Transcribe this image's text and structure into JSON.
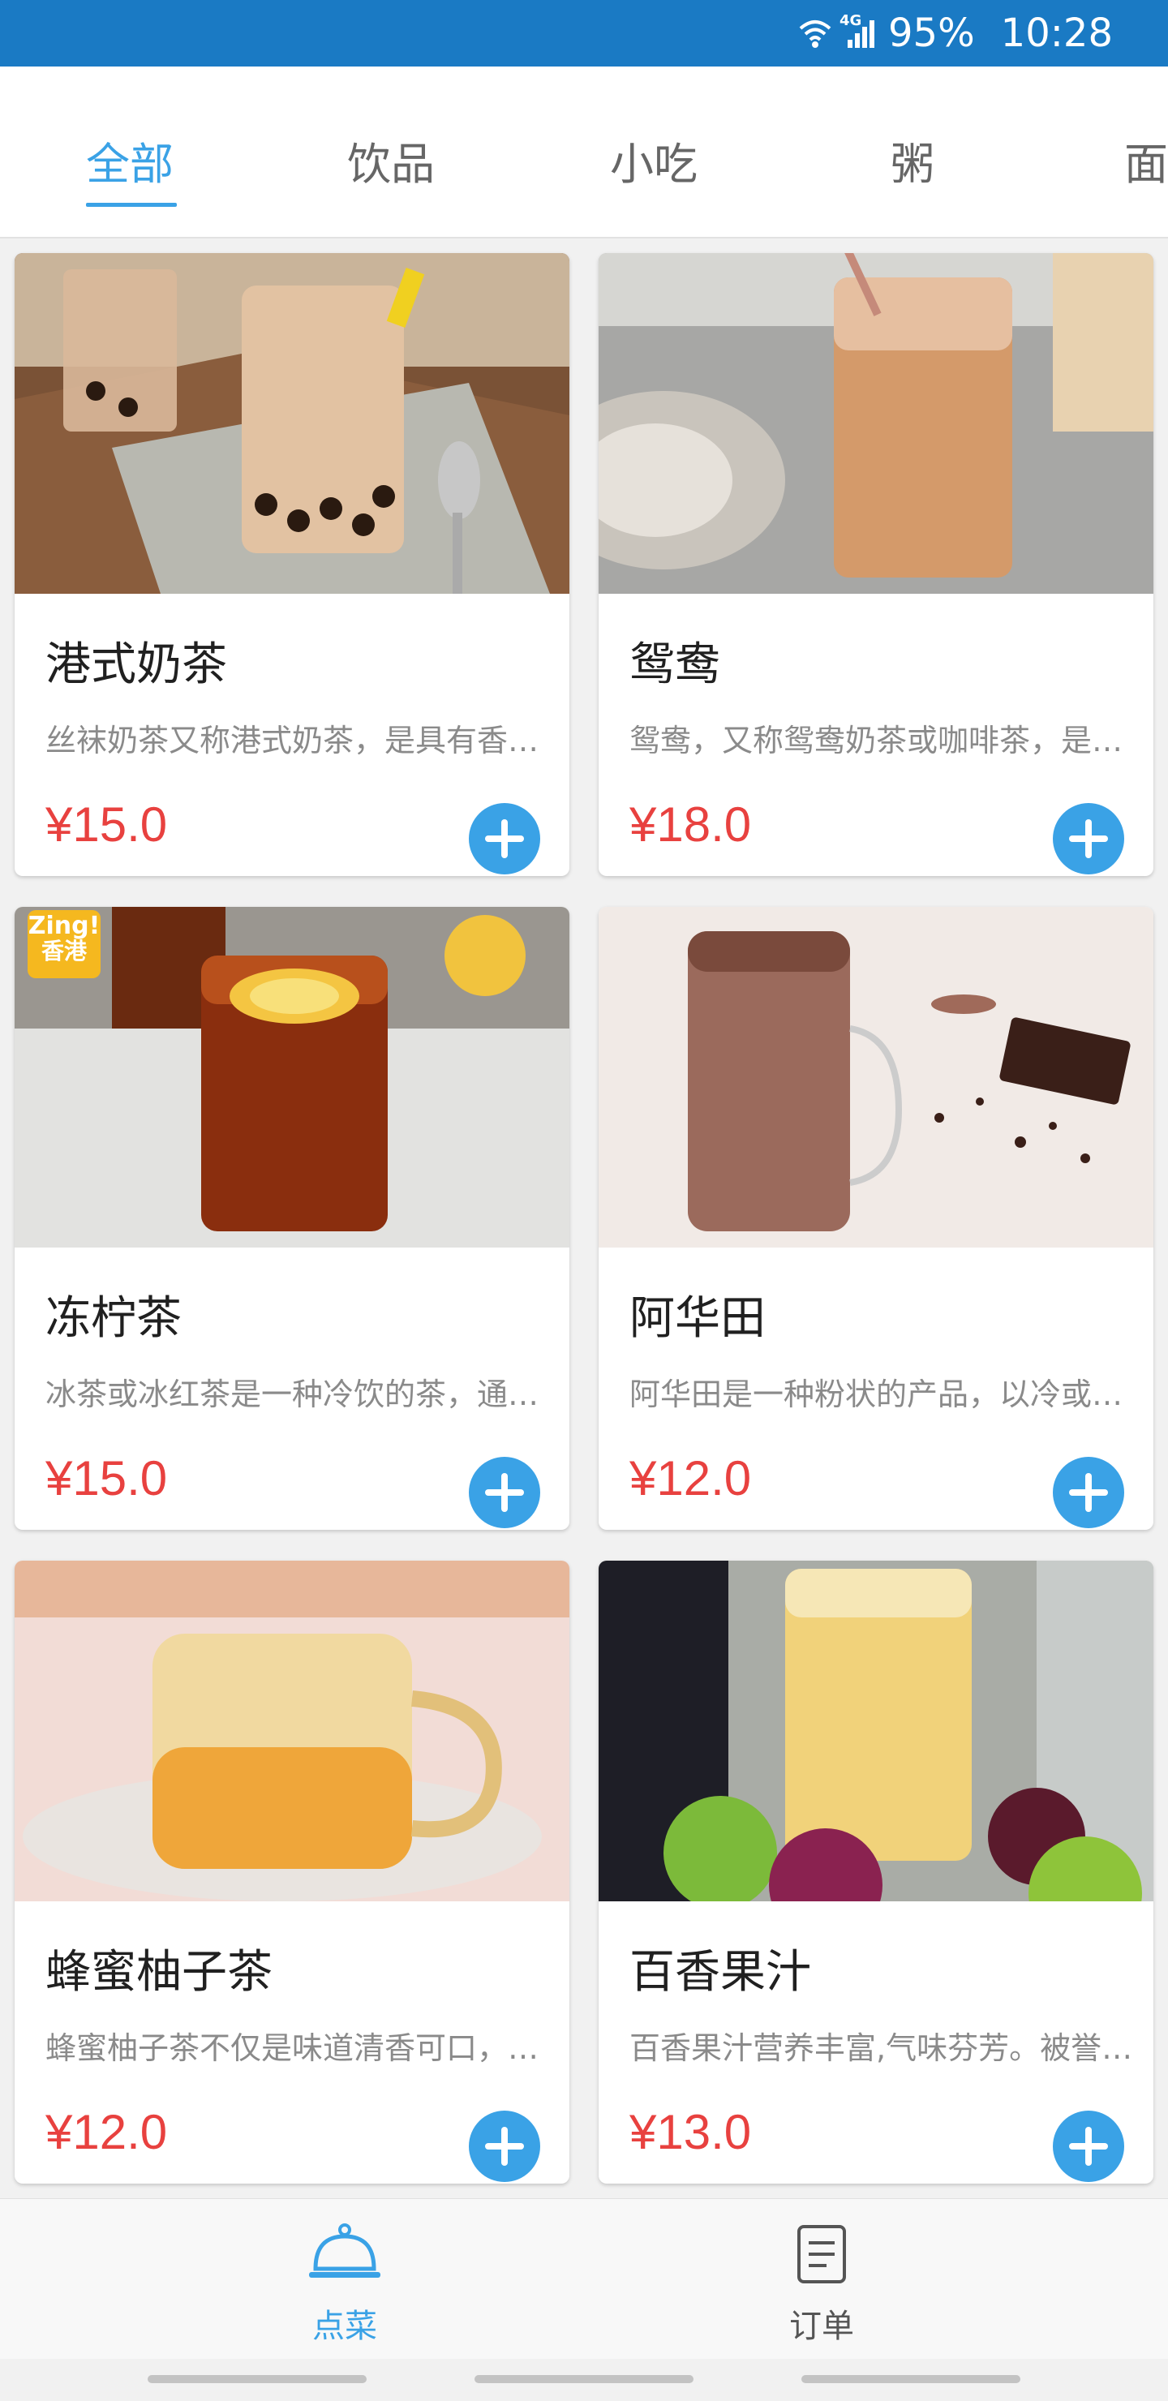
{
  "status_bar": {
    "network": "4G",
    "battery": "95%",
    "time": "10:28",
    "icons": [
      "wifi-icon",
      "signal-icon"
    ],
    "background": "#1a7ac4"
  },
  "tabs": [
    {
      "label": "全部",
      "active": true
    },
    {
      "label": "饮品",
      "active": false
    },
    {
      "label": "小吃",
      "active": false
    },
    {
      "label": "粥",
      "active": false
    },
    {
      "label": "面",
      "active": false
    }
  ],
  "accent_color": "#3aa2e6",
  "price_color": "#e8413f",
  "items": [
    {
      "name": "港式奶茶",
      "desc": "丝袜奶茶又称港式奶茶，是具有香港特色的奶茶",
      "price": "¥15.0"
    },
    {
      "name": "鸳鸯",
      "desc": "鸳鸯，又称鸳鸯奶茶或咖啡茶，是香港特色饮品",
      "price": "¥18.0"
    },
    {
      "name": "冻柠茶",
      "desc": "冰茶或冰红茶是一种冷饮的茶，通常加入柠檬",
      "price": "¥15.0",
      "badge": [
        "Zing!",
        "香港"
      ]
    },
    {
      "name": "阿华田",
      "desc": "阿华田是一种粉状的产品，以冷或热牛奶冲调",
      "price": "¥12.0"
    },
    {
      "name": "蜂蜜柚子茶",
      "desc": "蜂蜜柚子茶不仅是味道清香可口，而且有美白",
      "price": "¥12.0"
    },
    {
      "name": "百香果汁",
      "desc": "百香果汁营养丰富,气味芬芳。被誉为果汁之王",
      "price": "¥13.0"
    }
  ],
  "bottom_nav": [
    {
      "label": "点菜",
      "icon": "service-bell-icon",
      "active": true
    },
    {
      "label": "订单",
      "icon": "order-document-icon",
      "active": false
    }
  ]
}
